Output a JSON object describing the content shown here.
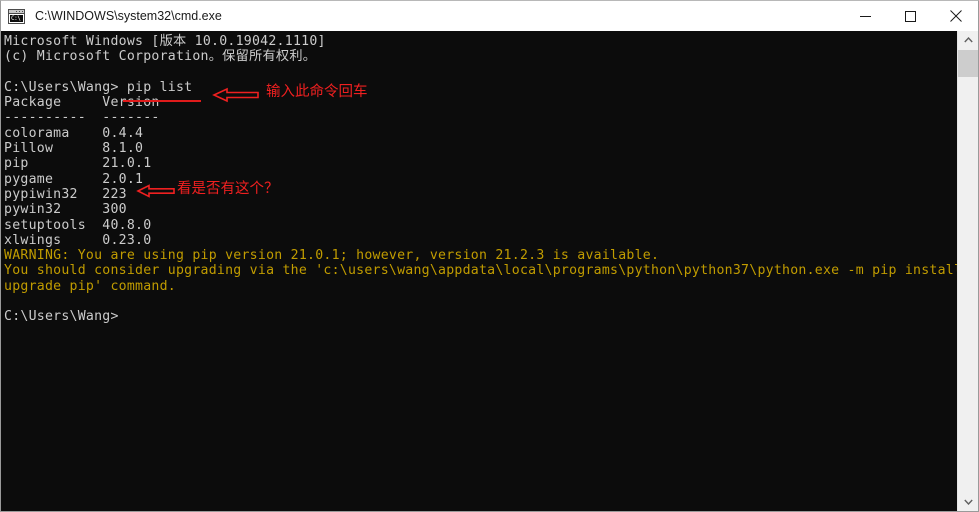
{
  "window": {
    "title": "C:\\WINDOWS\\system32\\cmd.exe",
    "icon_name": "cmd-icon",
    "icon_glyph": "C:\\",
    "minimize_label": "Minimize",
    "maximize_label": "Maximize",
    "close_label": "Close",
    "background_color": "#0c0c0c",
    "titlebar_color": "#ffffff"
  },
  "console": {
    "text_color": "#cccccc",
    "warning_color": "#c19c00",
    "lines": [
      {
        "text": "Microsoft Windows [版本 10.0.19042.1110]",
        "color": "normal"
      },
      {
        "text": "(c) Microsoft Corporation。保留所有权利。",
        "color": "normal"
      },
      {
        "text": "",
        "color": "normal"
      },
      {
        "text": "C:\\Users\\Wang> pip list",
        "color": "normal"
      },
      {
        "text": "Package     Version",
        "color": "normal"
      },
      {
        "text": "----------  -------",
        "color": "normal"
      },
      {
        "text": "colorama    0.4.4",
        "color": "normal"
      },
      {
        "text": "Pillow      8.1.0",
        "color": "normal"
      },
      {
        "text": "pip         21.0.1",
        "color": "normal"
      },
      {
        "text": "pygame      2.0.1",
        "color": "normal"
      },
      {
        "text": "pypiwin32   223",
        "color": "normal"
      },
      {
        "text": "pywin32     300",
        "color": "normal"
      },
      {
        "text": "setuptools  40.8.0",
        "color": "normal"
      },
      {
        "text": "xlwings     0.23.0",
        "color": "normal"
      },
      {
        "text": "WARNING: You are using pip version 21.0.1; however, version 21.2.3 is available.",
        "color": "warning"
      },
      {
        "text": "You should consider upgrading via the 'c:\\users\\wang\\appdata\\local\\programs\\python\\python37\\python.exe -m pip install --",
        "color": "warning"
      },
      {
        "text": "upgrade pip' command.",
        "color": "warning"
      },
      {
        "text": "",
        "color": "normal"
      },
      {
        "text": "C:\\Users\\Wang>",
        "color": "normal"
      }
    ]
  },
  "annotations": {
    "color": "#ef2020",
    "items": [
      {
        "text": "输入此命令回车",
        "arrow": "left-arrow-icon"
      },
      {
        "text": "看是否有这个？",
        "arrow": "left-arrow-icon"
      }
    ]
  },
  "scrollbar": {
    "up_label": "scroll-up",
    "down_label": "scroll-down",
    "thumb_label": "scrollbar-thumb"
  }
}
